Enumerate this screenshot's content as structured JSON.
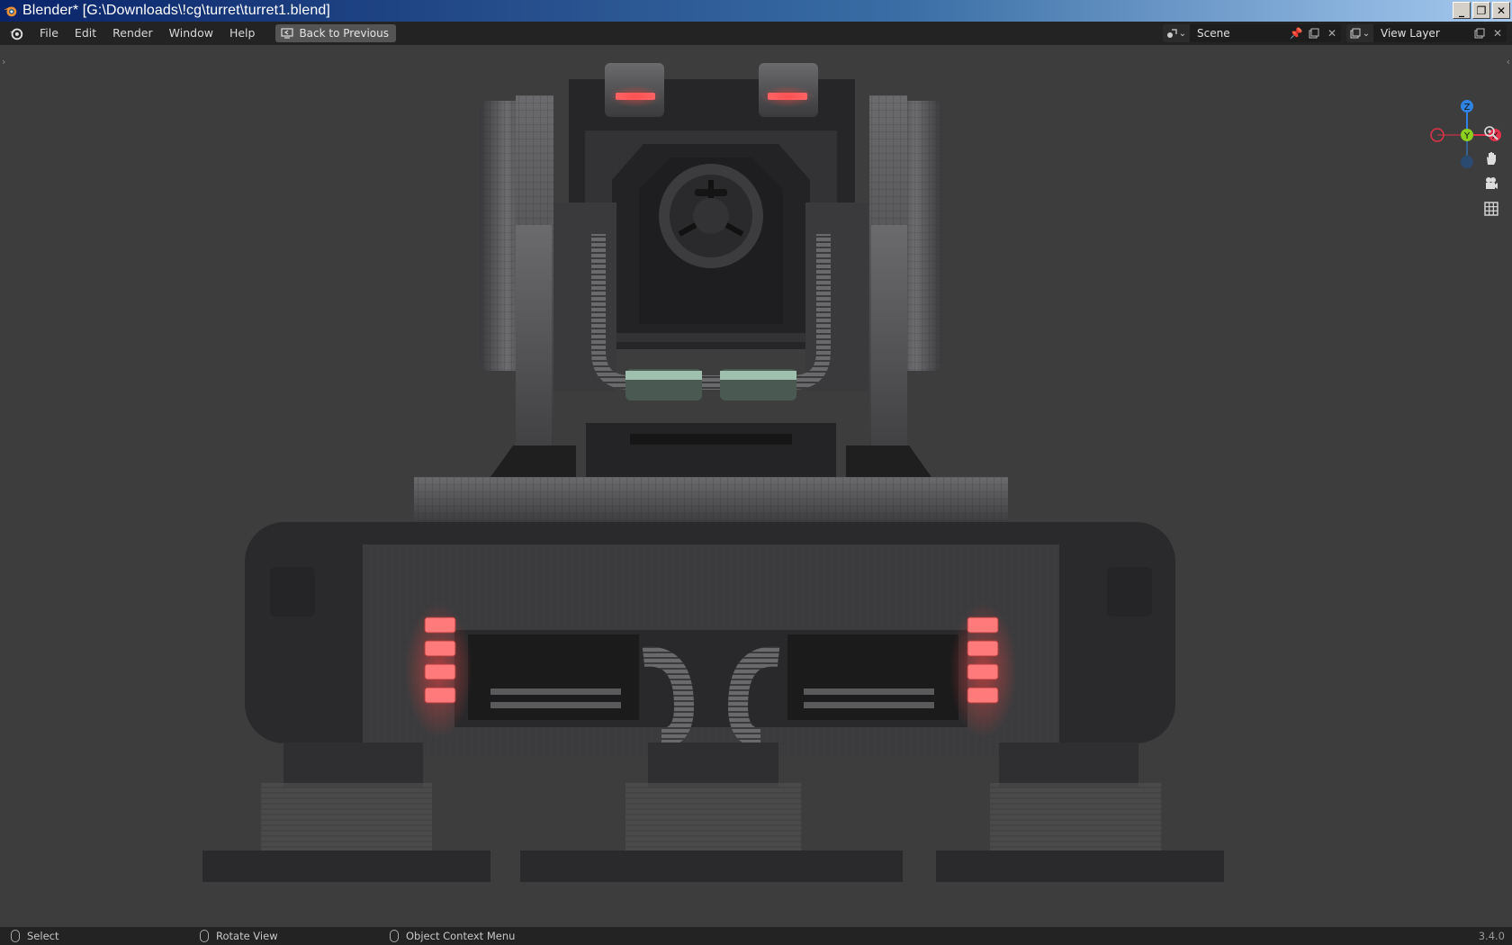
{
  "window": {
    "title": "Blender* [G:\\Downloads\\!cg\\turret\\turret1.blend]",
    "buttons": [
      "_",
      "❐",
      "✕"
    ]
  },
  "menubar": {
    "items": [
      "File",
      "Edit",
      "Render",
      "Window",
      "Help"
    ],
    "back_button": "Back to Previous",
    "scene": {
      "icon": "scene-icon",
      "value": "Scene"
    },
    "view_layer": {
      "icon": "render-layers-icon",
      "value": "View Layer"
    }
  },
  "gizmo": {
    "axes": {
      "z": "Z",
      "y": "Y",
      "x": "X"
    },
    "colors": {
      "x": "#e2324a",
      "y": "#8bd01f",
      "z": "#2f83e3"
    }
  },
  "nav_icons": [
    "zoom-icon",
    "hand-pan-icon",
    "camera-icon",
    "grid-ortho-icon"
  ],
  "statusbar": {
    "select": "Select",
    "rotate": "Rotate View",
    "context_menu": "Object Context Menu",
    "version": "3.4.0"
  },
  "colors": {
    "accent_glow": "#ff5a5a",
    "viewport_bg": "#3d3d3d",
    "header_bg": "#232323"
  }
}
